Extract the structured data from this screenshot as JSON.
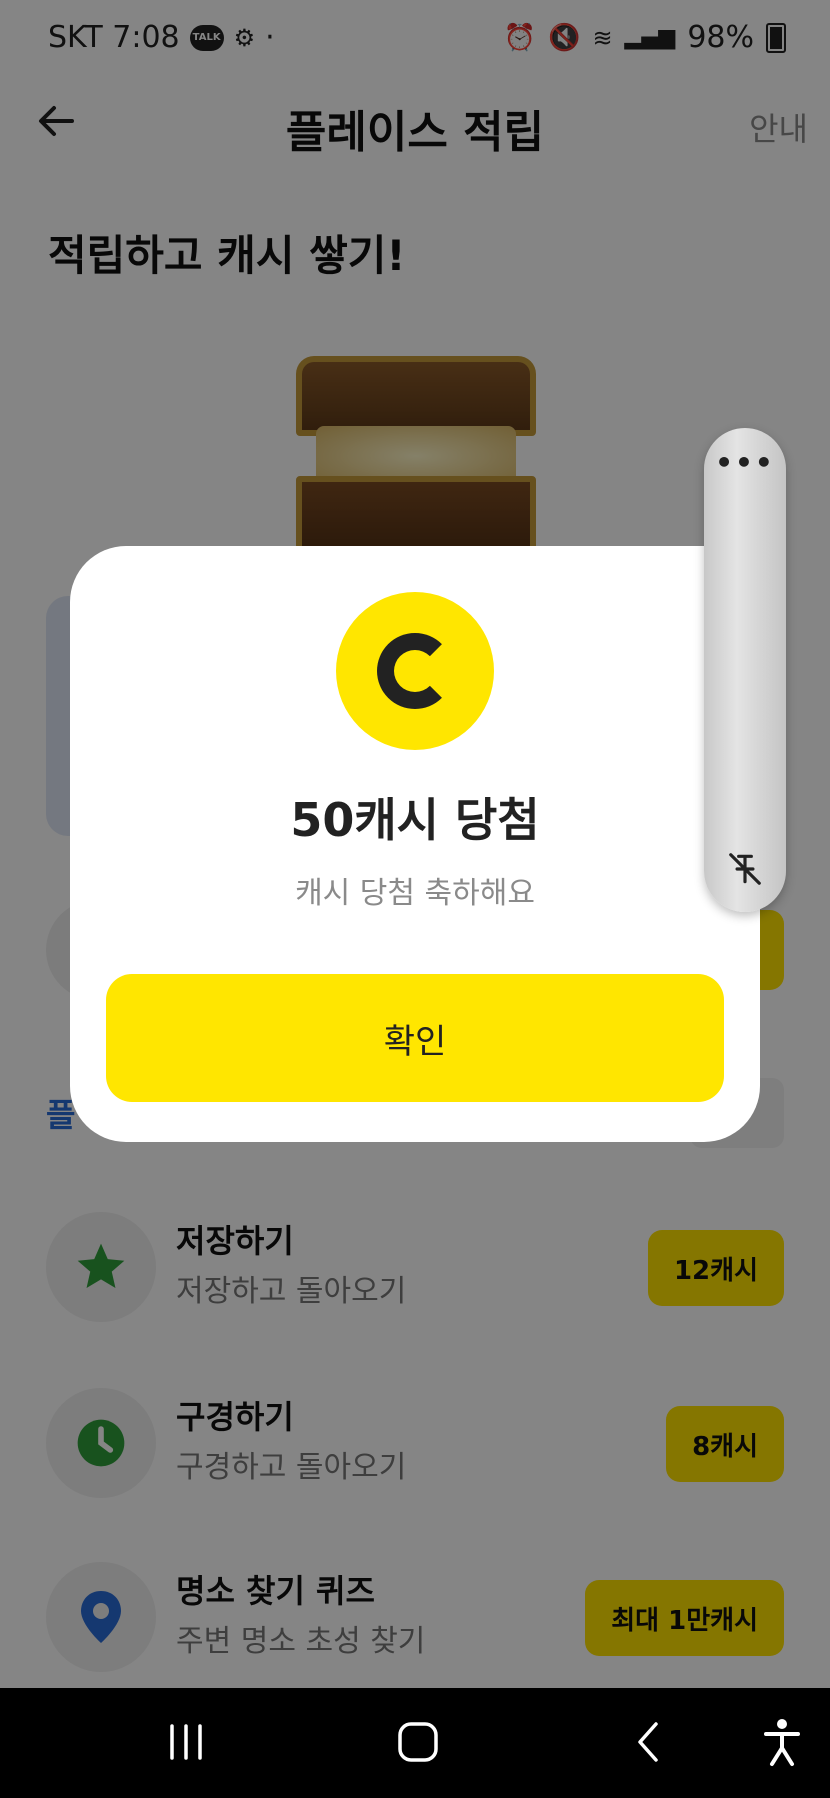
{
  "status_bar": {
    "carrier_time": "SKT 7:08",
    "talk_badge": "TALK",
    "signal_text": "·",
    "battery": "98%"
  },
  "header": {
    "title": "플레이스 적립",
    "guide_label": "안내"
  },
  "headline": "적립하고 캐시 쌓기!",
  "section": {
    "title": "플"
  },
  "missions": [
    {
      "name": "저장하기",
      "desc": "저장하고 돌아오기",
      "reward": "12캐시",
      "icon": "star-icon",
      "icon_color": "#2e9d3a"
    },
    {
      "name": "구경하기",
      "desc": "구경하고 돌아오기",
      "reward": "8캐시",
      "icon": "clock-icon",
      "icon_color": "#2e9d3a"
    },
    {
      "name": "명소 찾기 퀴즈",
      "desc": "주변 명소 초성 찾기",
      "reward": "최대 1만캐시",
      "icon": "location-pin-icon",
      "icon_color": "#2a6bd6"
    }
  ],
  "modal": {
    "title": "50캐시 당첨",
    "subtitle": "캐시 당첨 축하해요",
    "confirm_label": "확인",
    "coin_icon": "cash-coin-icon",
    "accent": "#ffe600"
  },
  "floating_panel": {
    "menu_label": "•••",
    "icon": "pin-off-icon"
  },
  "nav_bar": {
    "recent": "recent-apps-icon",
    "home": "home-icon",
    "back": "back-icon",
    "accessibility": "accessibility-icon"
  }
}
